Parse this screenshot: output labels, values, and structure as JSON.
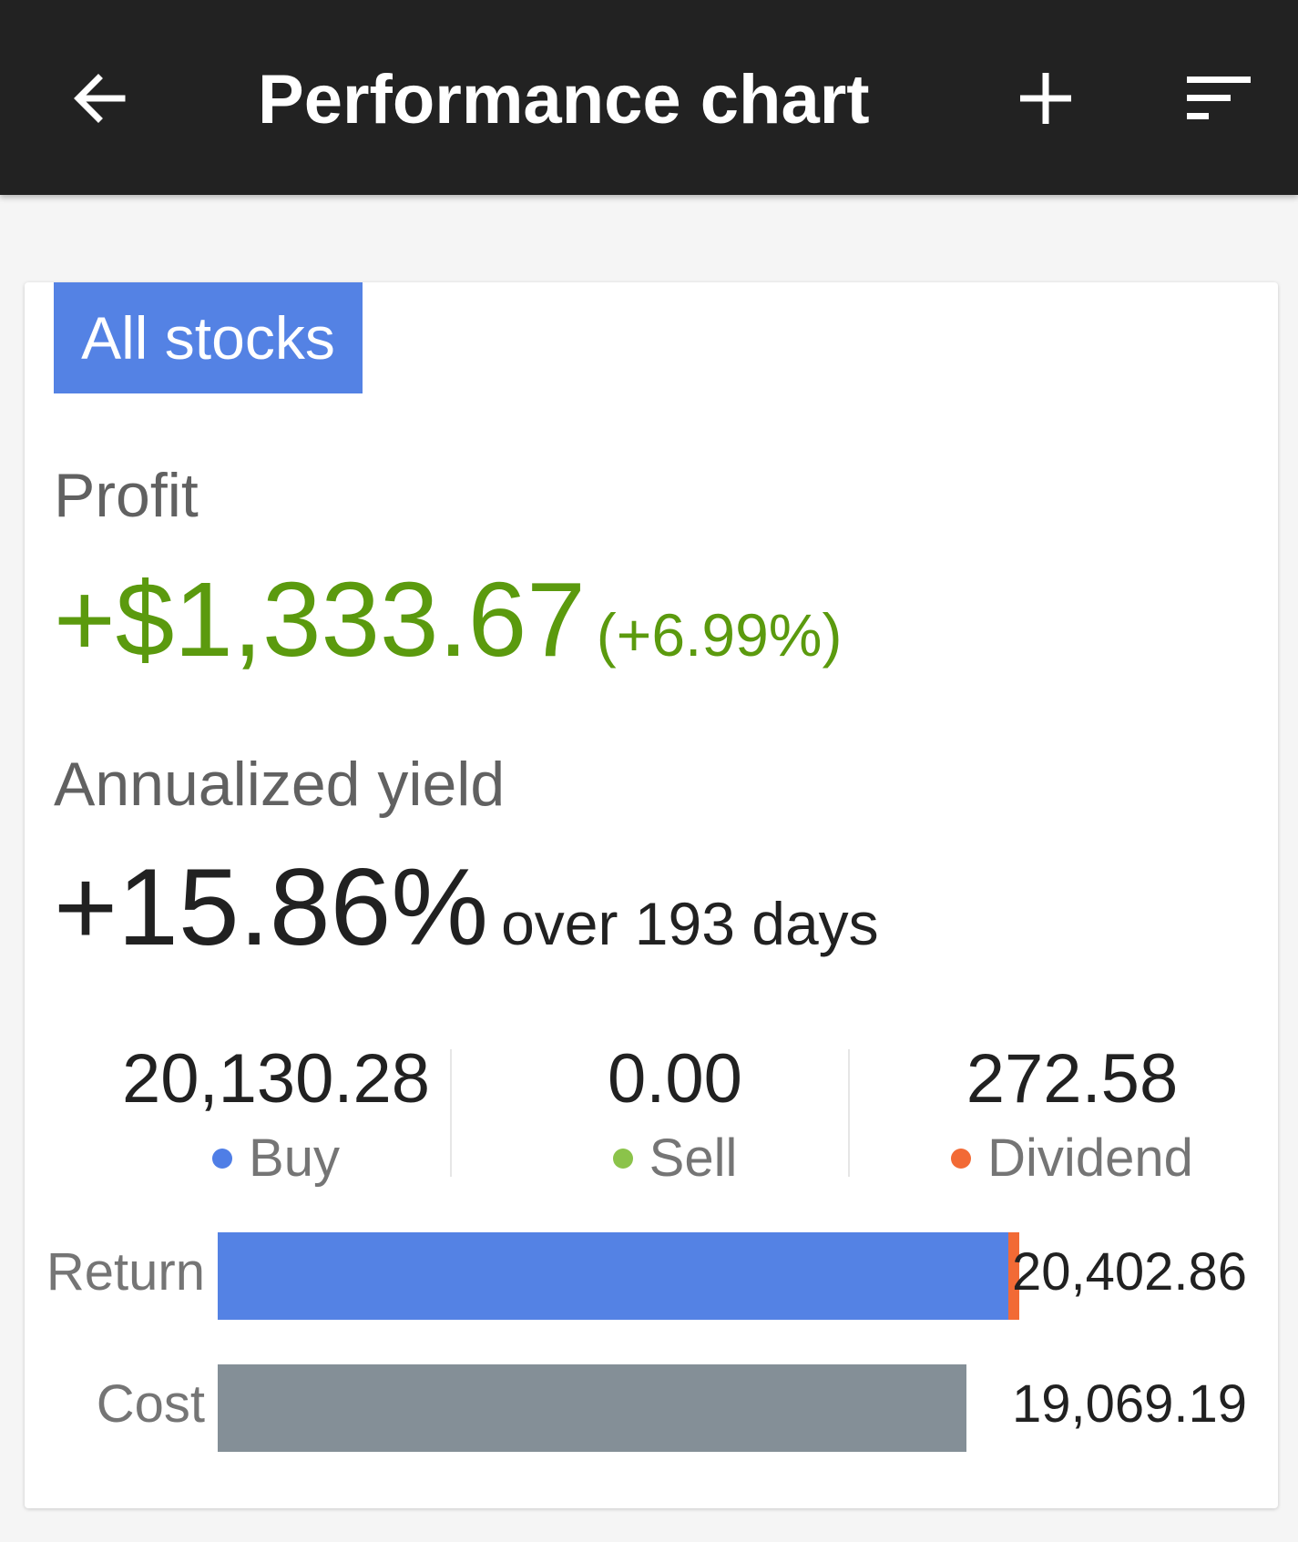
{
  "appbar": {
    "title": "Performance chart",
    "back_icon": "arrow-left-icon",
    "add_icon": "plus-icon",
    "sort_icon": "sort-icon"
  },
  "filter": {
    "label": "All stocks"
  },
  "profit": {
    "label": "Profit",
    "value": "+$1,333.67",
    "percent": "(+6.99%)"
  },
  "yield": {
    "label": "Annualized yield",
    "value": "+15.86%",
    "suffix": "over 193 days"
  },
  "stats": [
    {
      "value": "20,130.28",
      "label": "Buy",
      "color": "#4f7ee6"
    },
    {
      "value": "0.00",
      "label": "Sell",
      "color": "#8bc34a"
    },
    {
      "value": "272.58",
      "label": "Dividend",
      "color": "#f26a35"
    }
  ],
  "bars": {
    "max": 20402.86,
    "return": {
      "label": "Return",
      "value": "20,402.86",
      "segments": [
        {
          "name": "Buy",
          "amount": 20130.28,
          "color": "#5482e4"
        },
        {
          "name": "Sell",
          "amount": 0.0,
          "color": "#8bc34a"
        },
        {
          "name": "Dividend",
          "amount": 272.58,
          "color": "#f26a35"
        }
      ]
    },
    "cost": {
      "label": "Cost",
      "value": "19,069.19",
      "segments": [
        {
          "name": "Cost",
          "amount": 19069.19,
          "color": "#848f97"
        }
      ]
    }
  },
  "colors": {
    "appbar": "#222222",
    "accent": "#5482e4",
    "profit": "#5b9a0e"
  }
}
